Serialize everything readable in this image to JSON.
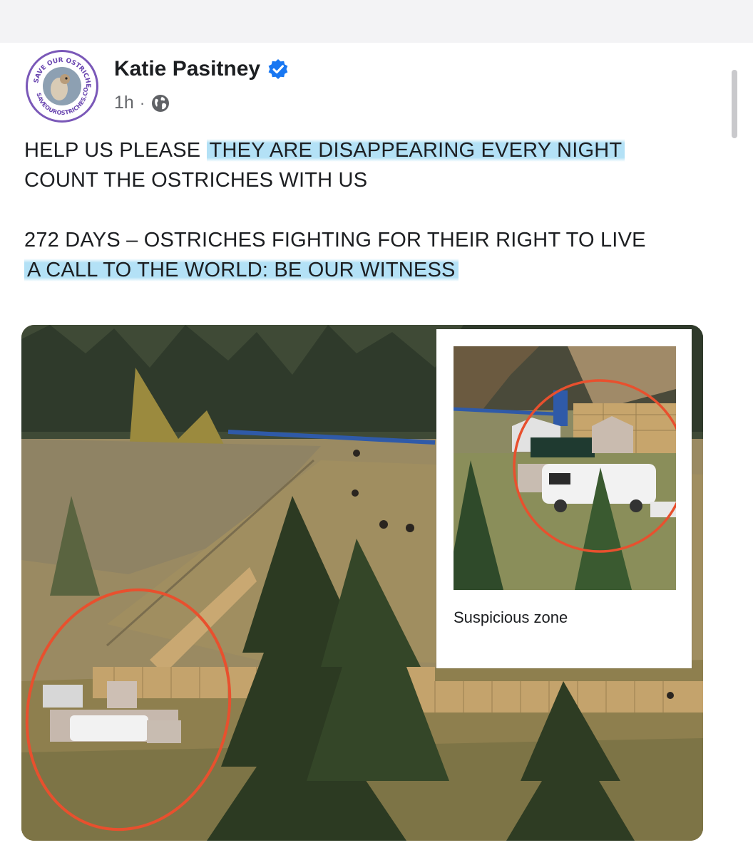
{
  "post": {
    "author": "Katie Pasitney",
    "time": "1h",
    "separator": "·",
    "avatar_text_top": "SAVE OUR OSTRICHES",
    "avatar_text_bottom": "SAVEOUROSTRICHES.COM",
    "lines": {
      "l1_plain": "HELP US PLEASE ",
      "l1_highlight": "THEY ARE DISAPPEARING EVERY NIGHT",
      "l2": "COUNT THE OSTRICHES WITH US",
      "l3": "272 DAYS – OSTRICHES FIGHTING FOR THEIR RIGHT TO LIVE",
      "l4_highlight": "A CALL TO THE WORLD: BE OUR WITNESS"
    }
  },
  "media": {
    "inset_caption": "Suspicious zone"
  },
  "colors": {
    "verified": "#1877f2",
    "highlight": "#a6dcf4",
    "circle_annotation": "#e8502e"
  },
  "icons": [
    "verified-badge-icon",
    "globe-icon"
  ]
}
